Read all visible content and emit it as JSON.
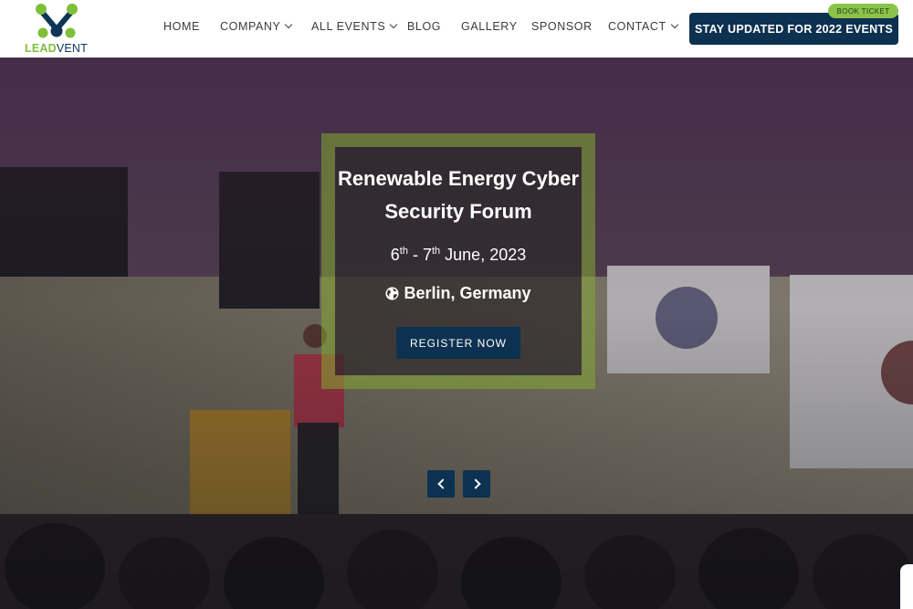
{
  "brand": {
    "lead": "LEAD",
    "vent": "VENT"
  },
  "nav": {
    "items": [
      {
        "label": "HOME",
        "dropdown": false
      },
      {
        "label": "COMPANY",
        "dropdown": true
      },
      {
        "label": "ALL EVENTS",
        "dropdown": true
      },
      {
        "label": "BLOG",
        "dropdown": false
      },
      {
        "label": "GALLERY",
        "dropdown": false
      },
      {
        "label": "SPONSOR",
        "dropdown": false
      },
      {
        "label": "CONTACT",
        "dropdown": true
      }
    ]
  },
  "cta": {
    "label": "STAY UPDATED FOR 2022 EVENTS",
    "badge": "BOOK TICKET"
  },
  "hero": {
    "title": "Renewable Energy Cyber Security Forum",
    "date_day1": "6",
    "date_sup1": "th",
    "date_sep": " - ",
    "date_day2": "7",
    "date_sup2": "th",
    "date_rest": " June, 2023",
    "location": "Berlin, Germany",
    "register_label": "REGISTER NOW"
  },
  "colors": {
    "navy": "#0d3150",
    "green": "#8bc34a"
  },
  "icons": {
    "location": "globe-icon",
    "prev": "chevron-left-icon",
    "next": "chevron-right-icon"
  }
}
